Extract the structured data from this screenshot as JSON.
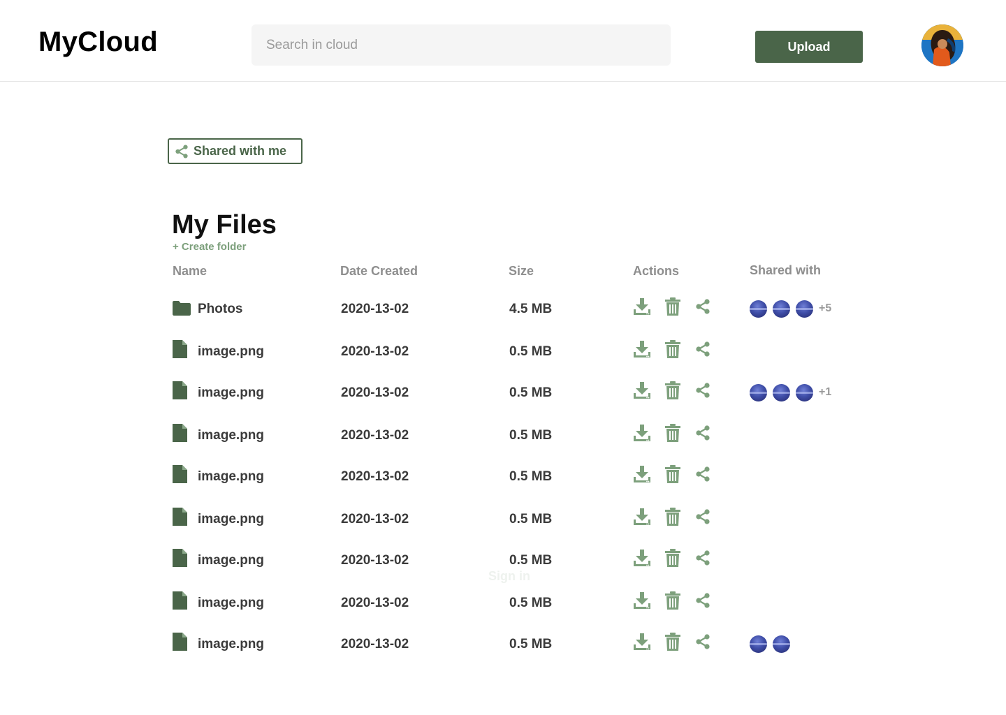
{
  "header": {
    "logo": "MyCloud",
    "search_placeholder": "Search in cloud",
    "upload_label": "Upload"
  },
  "toolbar": {
    "shared_with_me_label": "Shared with me"
  },
  "main": {
    "title": "My Files",
    "create_folder_label": "+ Create folder",
    "columns": {
      "name": "Name",
      "date": "Date Created",
      "size": "Size",
      "actions": "Actions",
      "shared": "Shared with"
    },
    "rows": [
      {
        "type": "folder",
        "name": "Photos",
        "date": "2020-13-02",
        "size": "4.5 MB",
        "shared_avatars": 3,
        "shared_more": "+5"
      },
      {
        "type": "file",
        "name": "image.png",
        "date": "2020-13-02",
        "size": "0.5 MB",
        "shared_avatars": 0,
        "shared_more": ""
      },
      {
        "type": "file",
        "name": "image.png",
        "date": "2020-13-02",
        "size": "0.5 MB",
        "shared_avatars": 3,
        "shared_more": "+1"
      },
      {
        "type": "file",
        "name": "image.png",
        "date": "2020-13-02",
        "size": "0.5 MB",
        "shared_avatars": 0,
        "shared_more": ""
      },
      {
        "type": "file",
        "name": "image.png",
        "date": "2020-13-02",
        "size": "0.5 MB",
        "shared_avatars": 0,
        "shared_more": ""
      },
      {
        "type": "file",
        "name": "image.png",
        "date": "2020-13-02",
        "size": "0.5 MB",
        "shared_avatars": 0,
        "shared_more": ""
      },
      {
        "type": "file",
        "name": "image.png",
        "date": "2020-13-02",
        "size": "0.5 MB",
        "shared_avatars": 0,
        "shared_more": ""
      },
      {
        "type": "file",
        "name": "image.png",
        "date": "2020-13-02",
        "size": "0.5 MB",
        "shared_avatars": 0,
        "shared_more": ""
      },
      {
        "type": "file",
        "name": "image.png",
        "date": "2020-13-02",
        "size": "0.5 MB",
        "shared_avatars": 2,
        "shared_more": ""
      }
    ],
    "ghost_text": "Sign in"
  },
  "icons": {
    "folder": "folder-icon",
    "file": "file-icon",
    "download": "download-icon",
    "delete": "trash-icon",
    "share": "share-icon"
  },
  "colors": {
    "brand": "#4a6549",
    "icon_light": "#7da07c",
    "muted": "#8e8e8e"
  }
}
